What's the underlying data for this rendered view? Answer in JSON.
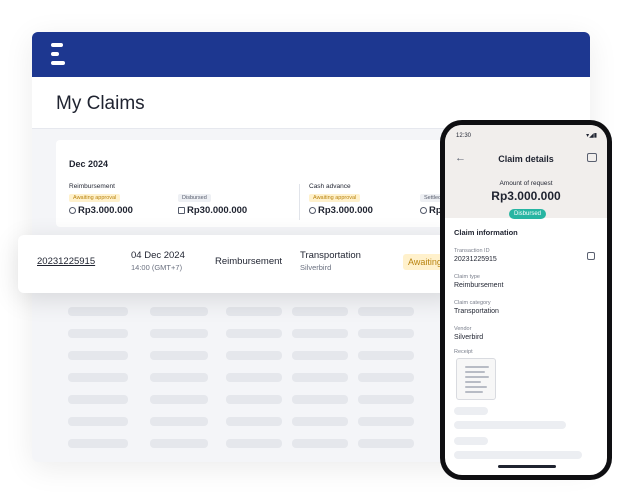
{
  "page": {
    "title": "My Claims"
  },
  "summary": {
    "month": "Dec 2024",
    "reimbursement": {
      "label": "Reimbursement",
      "awaiting_label": "Awaiting approval",
      "awaiting_amount": "Rp3.000.000",
      "disbursed_label": "Disbursed",
      "disbursed_amount": "Rp30.000.000"
    },
    "cash_advance": {
      "label": "Cash advance",
      "awaiting_label": "Awaiting approval",
      "awaiting_amount": "Rp3.000.000",
      "settled_label": "Settled",
      "settled_amount": "Rp"
    }
  },
  "claim_row": {
    "transaction_id": "20231225915",
    "date": "04 Dec 2024",
    "time": "14:00 (GMT+7)",
    "type": "Reimbursement",
    "category": "Transportation",
    "vendor": "Silverbird",
    "status": "Awaiting"
  },
  "phone": {
    "status_time": "12:30",
    "status_icons": "▾◢▮",
    "title": "Claim details",
    "amount_label": "Amount of request",
    "amount": "Rp3.000.000",
    "status": "Disbursed",
    "section_title": "Claim information",
    "fields": [
      {
        "label": "Transaction ID",
        "value": "20231225915"
      },
      {
        "label": "Claim type",
        "value": "Reimbursement"
      },
      {
        "label": "Claim category",
        "value": "Transportation"
      },
      {
        "label": "Vendor",
        "value": "Silverbird"
      }
    ],
    "receipt_label": "Receipt"
  },
  "colors": {
    "brand": "#1d3790",
    "awaiting": "#b98410",
    "disbursed": "#27b5a2",
    "link": "#2a49c4"
  },
  "icons": [
    "menu-icon",
    "coin-icon",
    "document-icon",
    "check-circle-icon",
    "back-arrow-icon",
    "copy-icon"
  ]
}
